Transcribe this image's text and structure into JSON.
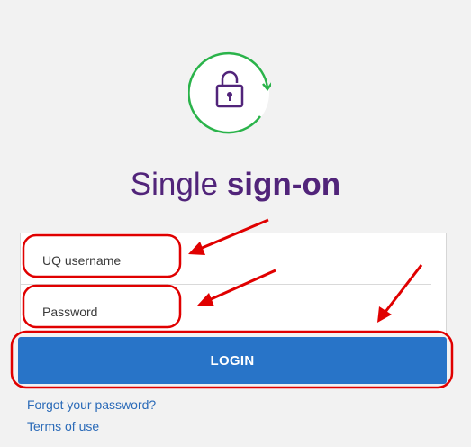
{
  "header": {
    "title_light": "Single ",
    "title_bold": "sign-on",
    "logo_icon": "padlock-refresh-icon",
    "logo_ring_color": "#2ab34a",
    "logo_lock_color": "#51247a"
  },
  "form": {
    "username_placeholder": "UQ username",
    "password_placeholder": "Password",
    "login_label": "LOGIN"
  },
  "links": {
    "forgot_password": "Forgot your password?",
    "terms_of_use": "Terms of use"
  },
  "colors": {
    "brand_purple": "#51247a",
    "button_blue": "#2874c8",
    "link_blue": "#2a6ab8",
    "annotation_red": "#e00000"
  }
}
